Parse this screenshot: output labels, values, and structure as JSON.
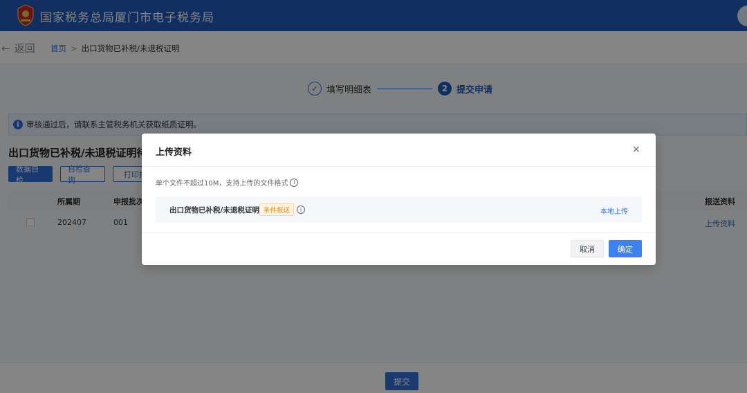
{
  "header": {
    "site_title": "国家税务总局厦门市电子税务局"
  },
  "breadcrumb": {
    "back_label": "返回",
    "home": "首页",
    "separator": ">",
    "current": "出口货物已补税/未退税证明"
  },
  "steps": [
    {
      "number": "✓",
      "label": "填写明细表",
      "status": "done"
    },
    {
      "number": "2",
      "label": "提交申请",
      "status": "active"
    }
  ],
  "notice": {
    "text": "审核通过后，请联系主管税务机关获取纸质证明。"
  },
  "section": {
    "title": "出口货物已补税/未退税证明待",
    "buttons": [
      "数据自检",
      "自检查询",
      "打印报"
    ]
  },
  "table": {
    "headers": [
      "所属期",
      "申报批次",
      "报送资料"
    ],
    "rows": [
      {
        "period": "202407",
        "batch": "001",
        "action": "上传资料"
      }
    ]
  },
  "footer": {
    "submit_label": "提交"
  },
  "modal": {
    "title": "上传资料",
    "close": "×",
    "hint": "单个文件不超过10M，支持上传的文件格式",
    "file": {
      "name": "出口货物已补税/未退税证明",
      "tag": "条件报送",
      "upload_label": "本地上传"
    },
    "cancel_label": "取消",
    "ok_label": "确定"
  },
  "colors": {
    "brand": "#1f5ab8",
    "primary": "#2f6fd8",
    "tag_orange": "#e38a1d"
  }
}
